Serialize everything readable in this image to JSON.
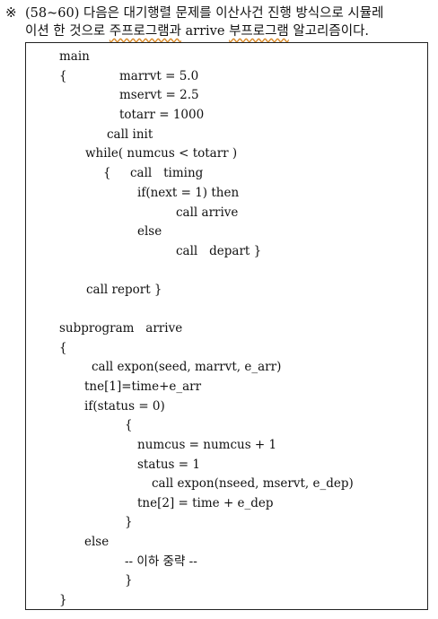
{
  "question": {
    "mark": "※",
    "line1": "(58~60) 다음은 대기행렬 문제를 이산사건 진행 방식으로 시뮬레",
    "line2_pre": "이션 한 것으로 ",
    "line2_u1": "주프로그램과",
    "line2_mid": " arrive ",
    "line2_u2": "부프로그램",
    "line2_post": " 알고리즘이다."
  },
  "code": [
    "main",
    "{",
    "marrvt = 5.0",
    "mservt = 2.5",
    "totarr = 1000",
    "call init",
    "while( numcus < totarr )",
    "{",
    "call   timing",
    "if(next = 1) then",
    "call arrive",
    "else",
    "call   depart }",
    "call report }",
    "subprogram   arrive",
    "{",
    "call expon(seed, marrvt, e_arr)",
    "tne[1]=time+e_arr",
    "if(status = 0)",
    "{",
    "numcus = numcus + 1",
    "status = 1",
    "call expon(nseed, mservt, e_dep)",
    "tne[2] = time + e_dep",
    "}",
    "else",
    "-- 이하 중략 --",
    "}",
    "}"
  ]
}
